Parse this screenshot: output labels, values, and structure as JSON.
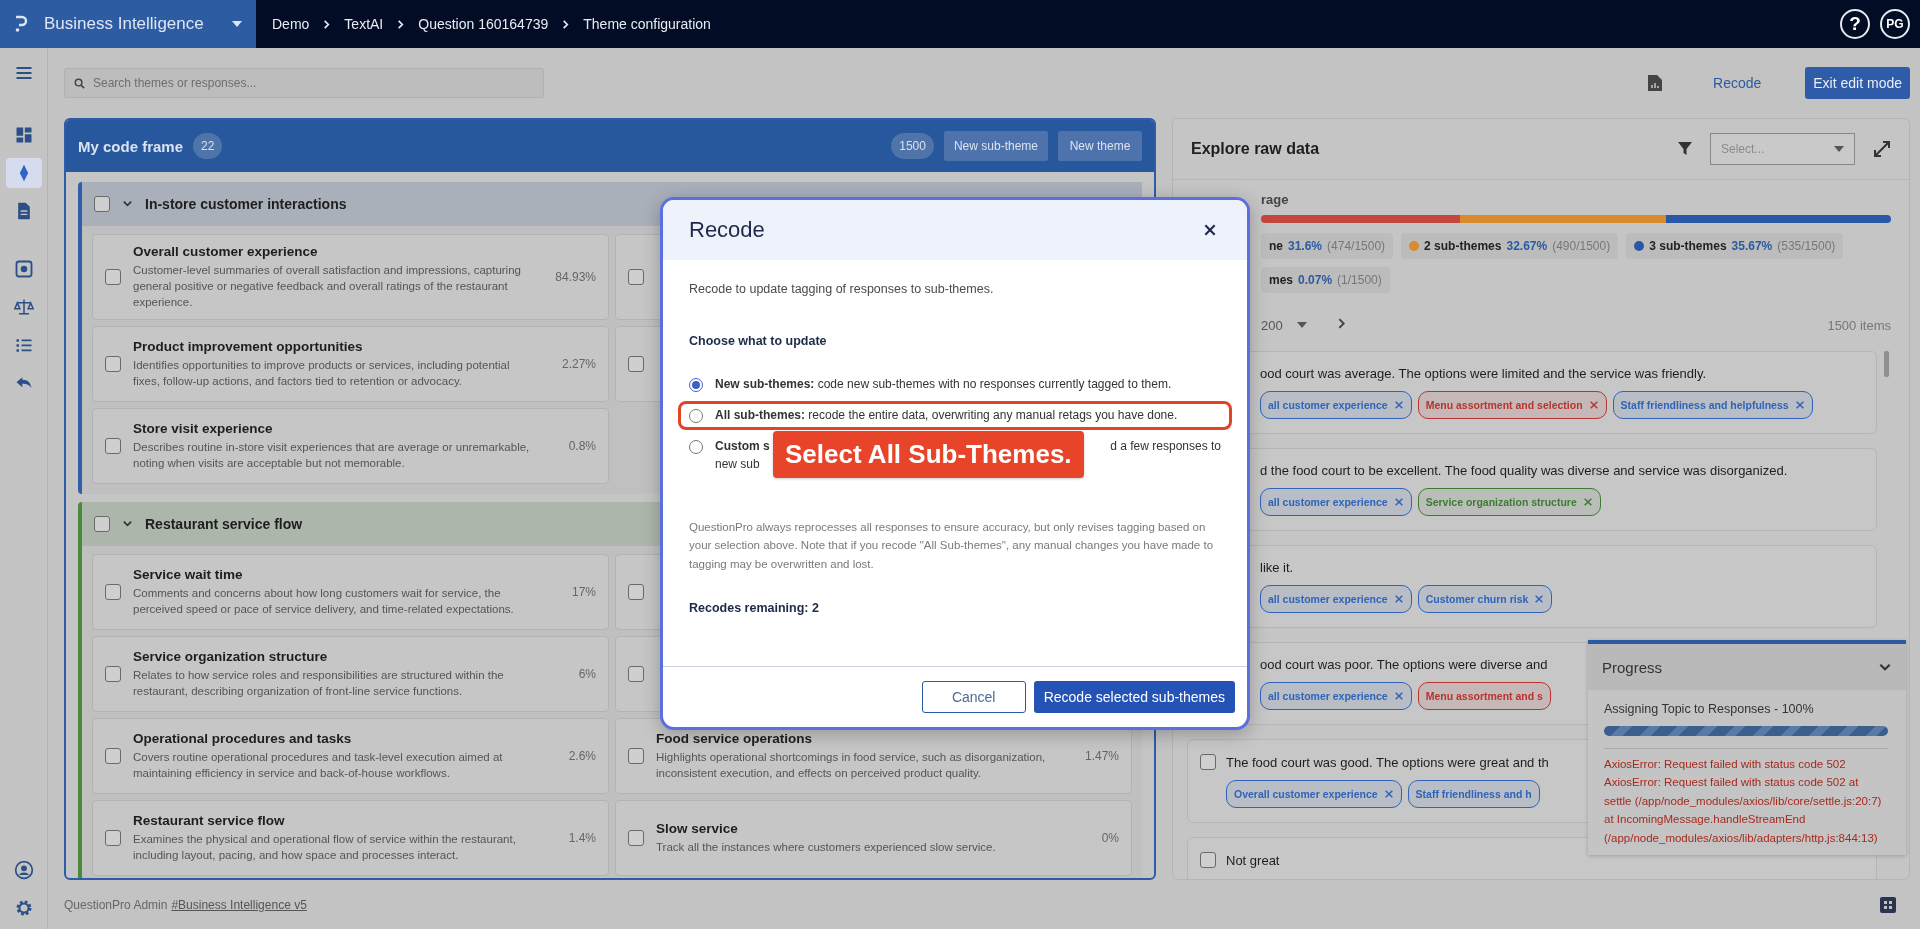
{
  "app": {
    "title": "Business Intelligence",
    "breadcrumb": [
      "Demo",
      "TextAI",
      "Question 160164739",
      "Theme configuration"
    ],
    "help": "?",
    "avatar": "PG"
  },
  "rail": {
    "top": [
      {
        "kind": "menu",
        "selected": false
      }
    ],
    "items": [
      {
        "kind": "dashboard",
        "selected": false
      },
      {
        "kind": "diamond",
        "selected": true
      },
      {
        "kind": "document",
        "selected": false
      }
    ],
    "tools": [
      {
        "kind": "focus",
        "selected": false
      },
      {
        "kind": "scale",
        "selected": false
      },
      {
        "kind": "list",
        "selected": false
      },
      {
        "kind": "reply",
        "selected": false
      }
    ],
    "bottom": [
      {
        "kind": "user",
        "selected": false
      },
      {
        "kind": "settings",
        "selected": false
      }
    ]
  },
  "toolbar": {
    "search": {
      "placeholder": "Search themes or responses..."
    },
    "recode": "Recode",
    "exit": "Exit edit mode"
  },
  "code_frame": {
    "title": "My code frame",
    "count": "22",
    "total": "1500",
    "buttons": [
      "New sub-theme",
      "New theme"
    ],
    "groups": [
      {
        "title": "In-store customer interactions",
        "checked": false,
        "expanded": true,
        "color": "#2f5fa6",
        "cards": [
          {
            "title": "Overall customer experience",
            "description": "Customer-level summaries of overall satisfaction and impressions, capturing general positive or negative feedback and overall ratings of the restaurant experience.",
            "percent": "84.93%",
            "checked": false
          },
          {
            "checked": false
          },
          {
            "title": "Product improvement opportunities",
            "description": "Identifies opportunities to improve products or services, including potential fixes, follow-up actions, and factors tied to retention or advocacy.",
            "percent": "2.27%",
            "checked": false
          },
          {
            "checked": false
          },
          {
            "title": "Store visit experience",
            "description": "Describes routine in-store visit experiences that are average or unremarkable, noting when visits are acceptable but not memorable.",
            "percent": "0.8%",
            "checked": false
          }
        ]
      },
      {
        "title": "Restaurant service flow",
        "checked": false,
        "expanded": true,
        "color": "#4a8a3a",
        "cards": [
          {
            "title": "Service wait time",
            "description": "Comments and concerns about how long customers wait for service, the perceived speed or pace of service delivery, and time-related expectations.",
            "percent": "17%",
            "checked": false
          },
          {
            "checked": false
          },
          {
            "title": "Service organization structure",
            "description": "Relates to how service roles and responsibilities are structured within the restaurant, describing organization of front-line service functions.",
            "percent": "6%",
            "checked": false
          },
          {
            "checked": false
          },
          {
            "title": "Operational procedures and tasks",
            "description": "Covers routine operational procedures and task-level execution aimed at maintaining efficiency in service and back-of-house workflows.",
            "percent": "2.6%",
            "checked": false
          },
          {
            "title": "Food service operations",
            "description": "Highlights operational shortcomings in food service, such as disorganization, inconsistent execution, and effects on perceived product quality.",
            "percent": "1.47%",
            "checked": false
          },
          {
            "title": "Restaurant service flow",
            "description": "Examines the physical and operational flow of service within the restaurant, including layout, pacing, and how space and processes interact.",
            "percent": "1.4%",
            "checked": false
          },
          {
            "title": "Slow service",
            "description": "Track all the instances where customers experienced slow service.",
            "percent": "0%",
            "checked": false
          }
        ]
      }
    ]
  },
  "raw_data": {
    "title": "Explore raw data",
    "select": {
      "placeholder": "Select..."
    },
    "coverage_label": "rage",
    "legend": [
      {
        "label": "ne",
        "percent": "31.6%",
        "count": "(474/1500)",
        "color": "#c4463f",
        "dot": false
      },
      {
        "label": "2 sub-themes",
        "percent": "32.67%",
        "count": "(490/1500)",
        "color": "#d88a2c",
        "dot": true
      },
      {
        "label": "3 sub-themes",
        "percent": "35.67%",
        "count": "(535/1500)",
        "color": "#2a58a8",
        "dot": true
      },
      {
        "label": "mes",
        "percent": "0.07%",
        "count": "(1/1500)",
        "dot": false
      }
    ],
    "page_size": "200",
    "items": "1500 items",
    "responses": [
      {
        "text": "ood court was average. The options were limited and the service was friendly.",
        "chips": [
          {
            "label": "all customer experience",
            "color": "#2f64b8",
            "close_icon": true
          },
          {
            "label": "Menu assortment and selection",
            "color": "#b8342e",
            "close_icon": true
          },
          {
            "label": "Staff friendliness and helpfulness",
            "color": "#2f64b8",
            "close_icon": true
          }
        ]
      },
      {
        "text": "d the food court to be excellent. The food quality was diverse and service was disorganized.",
        "chips": [
          {
            "label": "all customer experience",
            "color": "#2f64b8",
            "close_icon": true
          },
          {
            "label": "Service organization structure",
            "color": "#3f7a35",
            "close_icon": true
          }
        ]
      },
      {
        "text": "like it.",
        "chips": [
          {
            "label": "all customer experience",
            "color": "#2f64b8",
            "close_icon": true
          },
          {
            "label": "Customer churn risk",
            "color": "#2f64b8",
            "close_icon": true
          }
        ]
      },
      {
        "text": "ood court was poor. The options were diverse and",
        "chips": [
          {
            "label": "all customer experience",
            "color": "#2f64b8",
            "close_icon": true
          },
          {
            "label": "Menu assortment and s",
            "color": "#b8342e",
            "close_icon": false
          }
        ]
      },
      {
        "text": "The food court was good. The options were great and th",
        "checked": false,
        "chips": [
          {
            "label": "Overall customer experience",
            "color": "#2f64b8",
            "close_icon": true
          },
          {
            "label": "Staff friendliness and h",
            "color": "#2f64b8",
            "close_icon": false
          }
        ]
      },
      {
        "text": "Not great",
        "checked": false
      }
    ]
  },
  "progress": {
    "title": "Progress",
    "expanded": true,
    "task": "Assigning Topic to Responses - 100%",
    "level": 1,
    "errors": [
      "AxiosError: Request failed with status code 502",
      "AxiosError: Request failed with status code 502 at settle (/app/node_modules/axios/lib/core/settle.js:20:7) at IncomingMessage.handleStreamEnd (/app/node_modules/axios/lib/adapters/http.js:844:13)"
    ]
  },
  "footer": {
    "text": "QuestionPro Admin",
    "link": "#Business Intelligence v5"
  },
  "modal": {
    "title": "Recode",
    "intro": "Recode to update tagging of responses to sub-themes.",
    "heading": "Choose what to update",
    "options": [
      {
        "kind": "full",
        "text": "**New sub-themes:** code new sub-themes with no responses currently tagged to them.",
        "selected": true,
        "highlighted": false
      },
      {
        "kind": "full",
        "text": "**All sub-themes:** recode the entire data, overwriting any manual retags you have done.",
        "selected": false,
        "highlighted": true
      },
      {
        "kind": "covered",
        "text": "Custom s",
        "text_end": "d a few responses to",
        "text_line2": "new sub",
        "selected": false,
        "highlighted": false
      }
    ],
    "note": "QuestionPro always reprocesses all responses to ensure accuracy, but only revises tagging based on your selection above. Note that if you recode \"All Sub-themes\", any manual changes you have made to tagging may be overwritten and lost.",
    "remaining": "Recodes remaining: 2",
    "cancel": "Cancel",
    "confirm": "Recode selected sub-themes"
  },
  "annotation": {
    "callout": "Select All Sub-Themes."
  }
}
